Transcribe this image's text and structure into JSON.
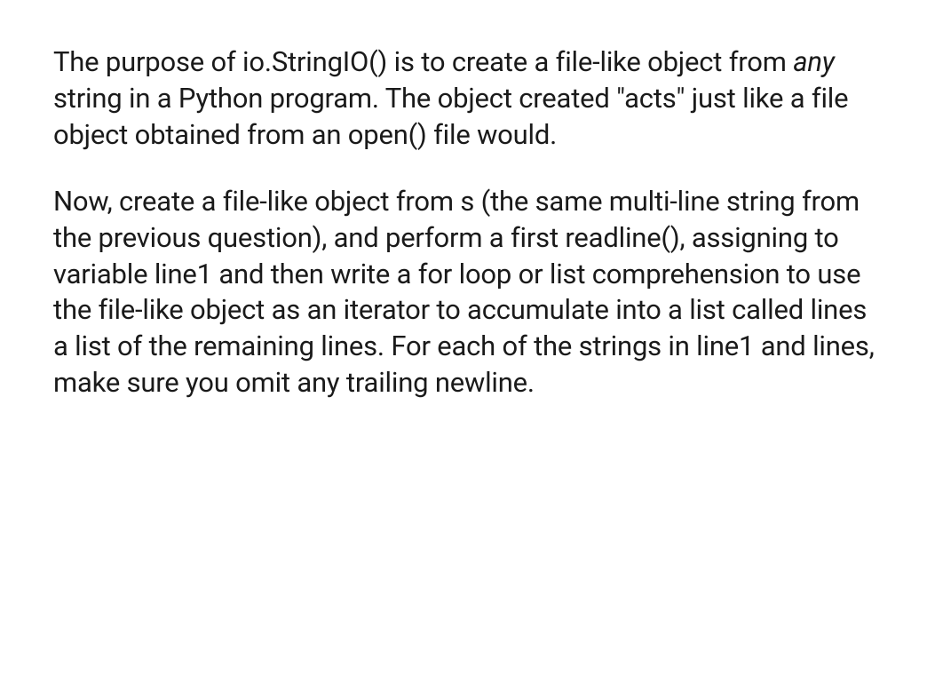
{
  "paragraphs": {
    "p1": {
      "part1": "The purpose of io.StringIO() is to create a file-like object from ",
      "italic": "any",
      "part2": " string in a Python program. The object created \"acts\" just like a file object obtained from an open() file would."
    },
    "p2": "Now, create a file-like object from s (the same multi-line string from the previous question), and perform a first readline(), assigning to variable line1 and then write a for loop or list comprehension to use the file-like object as an iterator to accumulate into a list called lines a list of the remaining lines. For each of the strings in line1 and lines, make sure you omit any trailing newline."
  }
}
